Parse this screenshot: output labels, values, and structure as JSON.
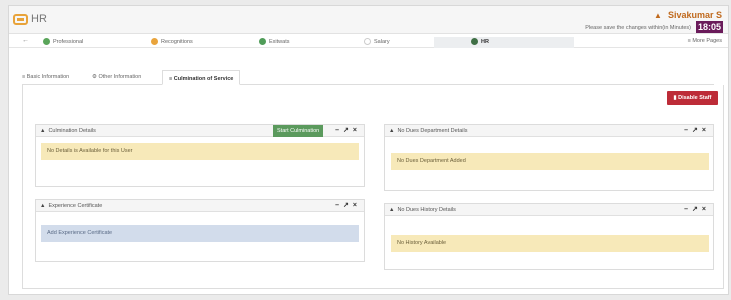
{
  "header": {
    "app_name": "HR",
    "user_name": "Sivakumar S",
    "save_message": "Please save the changes within(in Minutes)",
    "timer": "18:05"
  },
  "module_tabs": {
    "back_icon": "arrow-left-icon",
    "items": [
      {
        "label": "Professional",
        "color": "#5aa55a"
      },
      {
        "label": "Recognitions",
        "color": "#e9a43c"
      },
      {
        "label": "Exitwats",
        "color": "#4f9c58"
      },
      {
        "label": "Salary",
        "color": "#d9d9d9"
      },
      {
        "label": "HR",
        "color": "#3f6f45"
      }
    ],
    "active": "HR",
    "more_label": "≡ More Pages"
  },
  "sub_tabs": {
    "items": [
      {
        "label": "Basic Information",
        "icon": "list-icon"
      },
      {
        "label": "Other Information",
        "icon": "gear-icon"
      },
      {
        "label": "Culmination of Service",
        "icon": "list-icon"
      }
    ],
    "active": "Culmination of Service"
  },
  "actions": {
    "disable_staff_label": "Disable Staff"
  },
  "panels": {
    "culmination": {
      "title": "Culmination Details",
      "start_button": "Start Culmination",
      "message": "No Details is Available for this User"
    },
    "experience": {
      "title": "Experience Certificate",
      "message": "Add Experience Certificate"
    },
    "no_dues_dept": {
      "title": "No Dues Department Details",
      "message": "No Dues Department Added"
    },
    "no_dues_history": {
      "title": "No Dues History Details",
      "message": "No History Available"
    }
  }
}
